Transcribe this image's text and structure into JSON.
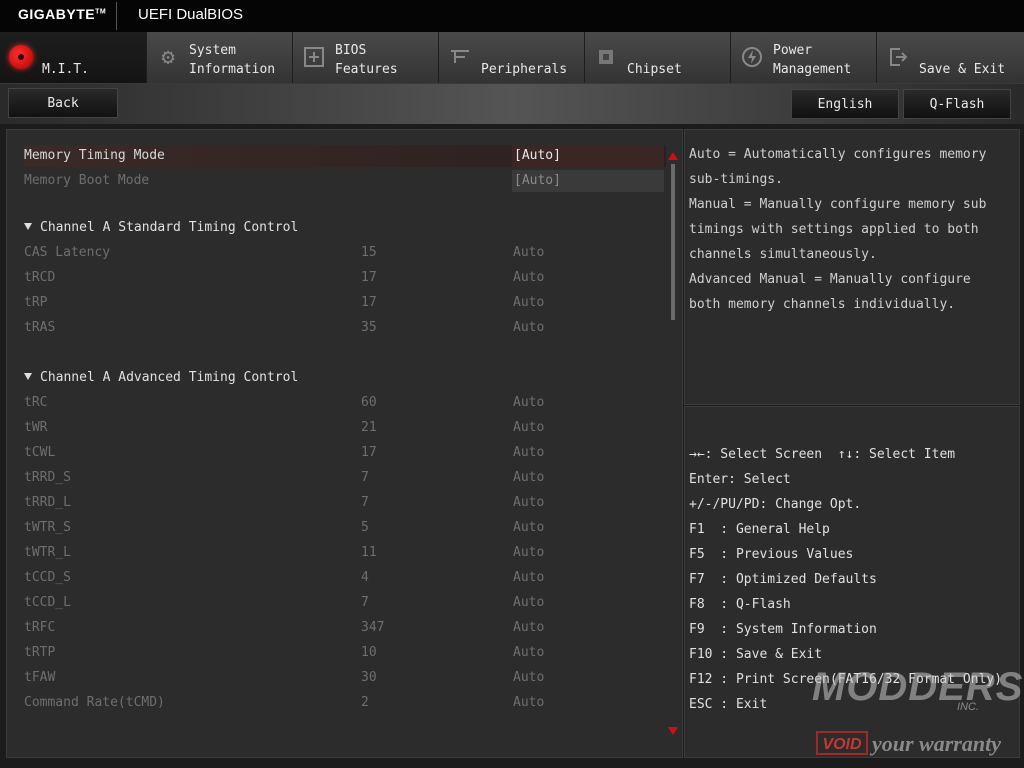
{
  "header": {
    "brand": "GIGABYTE",
    "brand_tm": "TM",
    "title": "UEFI DualBIOS"
  },
  "tabs": [
    {
      "label": "M.I.T.",
      "icon": "mit-icon",
      "active": true
    },
    {
      "label": "System\nInformation",
      "icon": "gear-icon"
    },
    {
      "label": "BIOS\nFeatures",
      "icon": "bios-icon"
    },
    {
      "label": "Peripherals",
      "icon": "peripherals-icon"
    },
    {
      "label": "Chipset",
      "icon": "chipset-icon"
    },
    {
      "label": "Power\nManagement",
      "icon": "power-icon"
    },
    {
      "label": "Save & Exit",
      "icon": "exit-icon"
    }
  ],
  "subbar": {
    "back": "Back",
    "language": "English",
    "qflash": "Q-Flash"
  },
  "settings": {
    "memory_timing_mode": {
      "label": "Memory Timing Mode",
      "value": "[Auto]"
    },
    "memory_boot_mode": {
      "label": "Memory Boot Mode",
      "value": "[Auto]"
    },
    "section_standard": "Channel A Standard Timing Control",
    "standard": [
      {
        "name": "CAS Latency",
        "value": "15",
        "setting": "Auto"
      },
      {
        "name": "tRCD",
        "value": "17",
        "setting": "Auto"
      },
      {
        "name": "tRP",
        "value": "17",
        "setting": "Auto"
      },
      {
        "name": "tRAS",
        "value": "35",
        "setting": "Auto"
      }
    ],
    "section_advanced": "Channel A Advanced Timing Control",
    "advanced": [
      {
        "name": "tRC",
        "value": "60",
        "setting": "Auto"
      },
      {
        "name": "tWR",
        "value": "21",
        "setting": "Auto"
      },
      {
        "name": "tCWL",
        "value": "17",
        "setting": "Auto"
      },
      {
        "name": "tRRD_S",
        "value": "7",
        "setting": "Auto"
      },
      {
        "name": "tRRD_L",
        "value": "7",
        "setting": "Auto"
      },
      {
        "name": "tWTR_S",
        "value": "5",
        "setting": "Auto"
      },
      {
        "name": "tWTR_L",
        "value": "11",
        "setting": "Auto"
      },
      {
        "name": "tCCD_S",
        "value": "4",
        "setting": "Auto"
      },
      {
        "name": "tCCD_L",
        "value": "7",
        "setting": "Auto"
      },
      {
        "name": "tRFC",
        "value": "347",
        "setting": "Auto"
      },
      {
        "name": "tRTP",
        "value": "10",
        "setting": "Auto"
      },
      {
        "name": "tFAW",
        "value": "30",
        "setting": "Auto"
      },
      {
        "name": "Command Rate(tCMD)",
        "value": "2",
        "setting": "Auto"
      }
    ]
  },
  "help": [
    "Auto = Automatically configures memory",
    "sub-timings.",
    "Manual = Manually configure memory sub",
    "timings with settings applied to both",
    "channels simultaneously.",
    "Advanced Manual = Manually configure",
    "both memory channels individually."
  ],
  "keys": [
    "→←: Select Screen  ↑↓: Select Item",
    "Enter: Select",
    "+/-/PU/PD: Change Opt.",
    "F1  : General Help",
    "F5  : Previous Values",
    "F7  : Optimized Defaults",
    "F8  : Q-Flash",
    "F9  : System Information",
    "F10 : Save & Exit",
    "F12 : Print Screen(FAT16/32 Format Only)",
    "ESC : Exit"
  ],
  "watermark": {
    "line1": "MODDERS",
    "line2": "INC.",
    "void": "VOID",
    "line3": "your warranty"
  },
  "colors": {
    "accent": "#d01010",
    "background": "#1c1c1c",
    "panel": "#2c2c2c"
  }
}
